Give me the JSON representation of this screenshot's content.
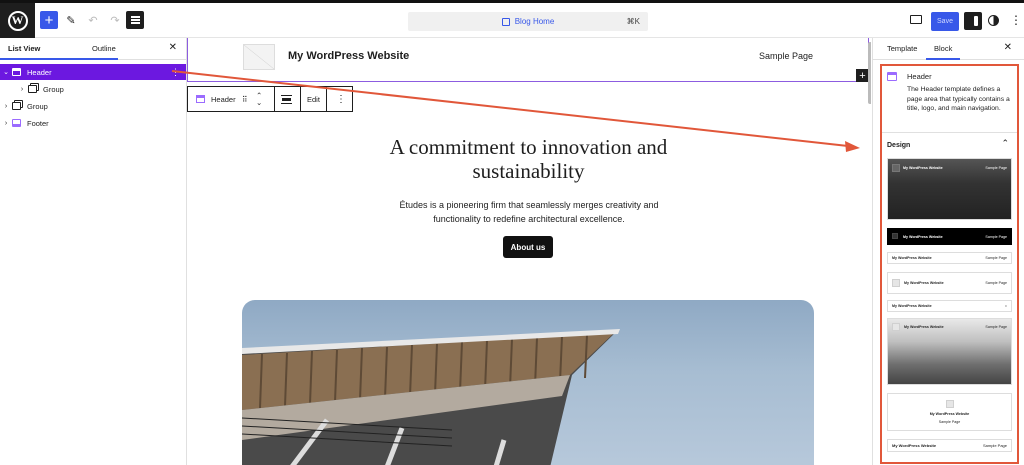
{
  "topbar": {
    "command_title": "Blog Home",
    "command_shortcut": "⌘K",
    "save_label": "Save",
    "icons": [
      "wordpress-logo",
      "plus-icon",
      "pencil-icon",
      "undo-icon",
      "redo-icon",
      "document-overview-icon",
      "desktop-icon",
      "settings-icon",
      "styles-icon",
      "more-icon"
    ]
  },
  "left_panel": {
    "tabs": [
      "List View",
      "Outline"
    ],
    "active_tab": "List View",
    "tree": [
      {
        "label": "Header",
        "level": 0,
        "expanded": true,
        "selected": true,
        "icon": "header-icon"
      },
      {
        "label": "Group",
        "level": 1,
        "expanded": false,
        "selected": false,
        "icon": "group-icon"
      },
      {
        "label": "Group",
        "level": 0,
        "expanded": false,
        "selected": false,
        "icon": "group-icon"
      },
      {
        "label": "Footer",
        "level": 0,
        "expanded": false,
        "selected": false,
        "icon": "footer-icon"
      }
    ]
  },
  "canvas": {
    "site_title": "My WordPress Website",
    "nav_link": "Sample Page",
    "block_toolbar": {
      "block_name": "Header",
      "edit_label": "Edit"
    },
    "headline": "A commitment to innovation and sustainability",
    "subtext": "Études is a pioneering firm that seamlessly merges creativity and functionality to redefine architectural excellence.",
    "button": "About us"
  },
  "right_panel": {
    "tabs": [
      "Template",
      "Block"
    ],
    "active_tab": "Block",
    "block_title": "Header",
    "block_description": "The Header template defines a page area that typically contains a title, logo, and main navigation.",
    "design_label": "Design",
    "previews": [
      {
        "title": "My WordPress Website",
        "page": "Sample Page"
      },
      {
        "title": "My WordPress Website",
        "page": "Sample Page"
      },
      {
        "title": "My WordPress Website",
        "page": "Sample Page"
      },
      {
        "title": "My WordPress Website",
        "page": "Sample Page"
      },
      {
        "title": "My WordPress Website",
        "page": "="
      },
      {
        "title": "My WordPress Website",
        "page": "Sample Page"
      },
      {
        "title": "My WordPress Website",
        "page": "Sample Page"
      },
      {
        "title": "My WordPress Website",
        "page": "Sample Page"
      }
    ]
  },
  "colors": {
    "accent": "#3858e9",
    "selection": "#6c18e0",
    "highlight_border": "#e1573a",
    "arrow": "#e1573a"
  }
}
